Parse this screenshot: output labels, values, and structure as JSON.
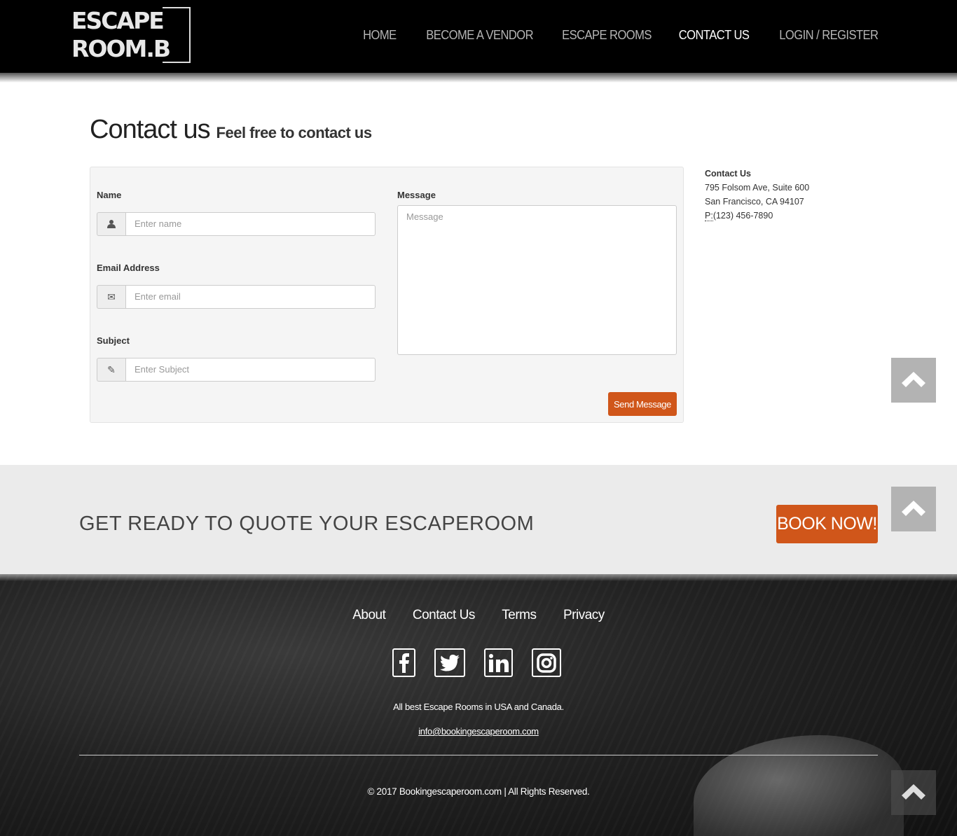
{
  "brand": {
    "logo_line1": "ESCAPE",
    "logo_line2": "ROOM.B"
  },
  "nav": [
    {
      "label": "HOME",
      "active": false
    },
    {
      "label": "BECOME A VENDOR",
      "active": false
    },
    {
      "label": "ESCAPE ROOMS",
      "active": false
    },
    {
      "label": "CONTACT US",
      "active": true
    },
    {
      "label": "LOGIN / REGISTER",
      "active": false
    }
  ],
  "page": {
    "title": "Contact us",
    "subtitle": "Feel free to contact us"
  },
  "form": {
    "name_label": "Name",
    "name_placeholder": "Enter name",
    "email_label": "Email Address",
    "email_placeholder": "Enter email",
    "subject_label": "Subject",
    "subject_placeholder": "Enter Subject",
    "message_label": "Message",
    "message_placeholder": "Message",
    "send_label": "Send Message"
  },
  "contact": {
    "heading": "Contact Us",
    "address1": "795 Folsom Ave, Suite 600",
    "address2": "San Francisco, CA 94107",
    "phone_abbr": "P:",
    "phone": "(123) 456-7890"
  },
  "cta": {
    "text": "GET READY TO QUOTE YOUR ESCAPEROOM",
    "button": "BOOK NOW!"
  },
  "footer": {
    "links": [
      "About",
      "Contact Us",
      "Terms",
      "Privacy"
    ],
    "social": [
      "facebook-icon",
      "twitter-icon",
      "linkedin-icon",
      "instagram-icon"
    ],
    "tagline": "All best Escape Rooms in USA and Canada.",
    "email": "info@bookingescaperoom.com",
    "copyright": "© 2017 Bookingescaperoom.com | All Rights Reserved."
  },
  "colors": {
    "accent": "#d0561a",
    "header_bg": "#000000",
    "cta_bg": "#ebebeb"
  }
}
